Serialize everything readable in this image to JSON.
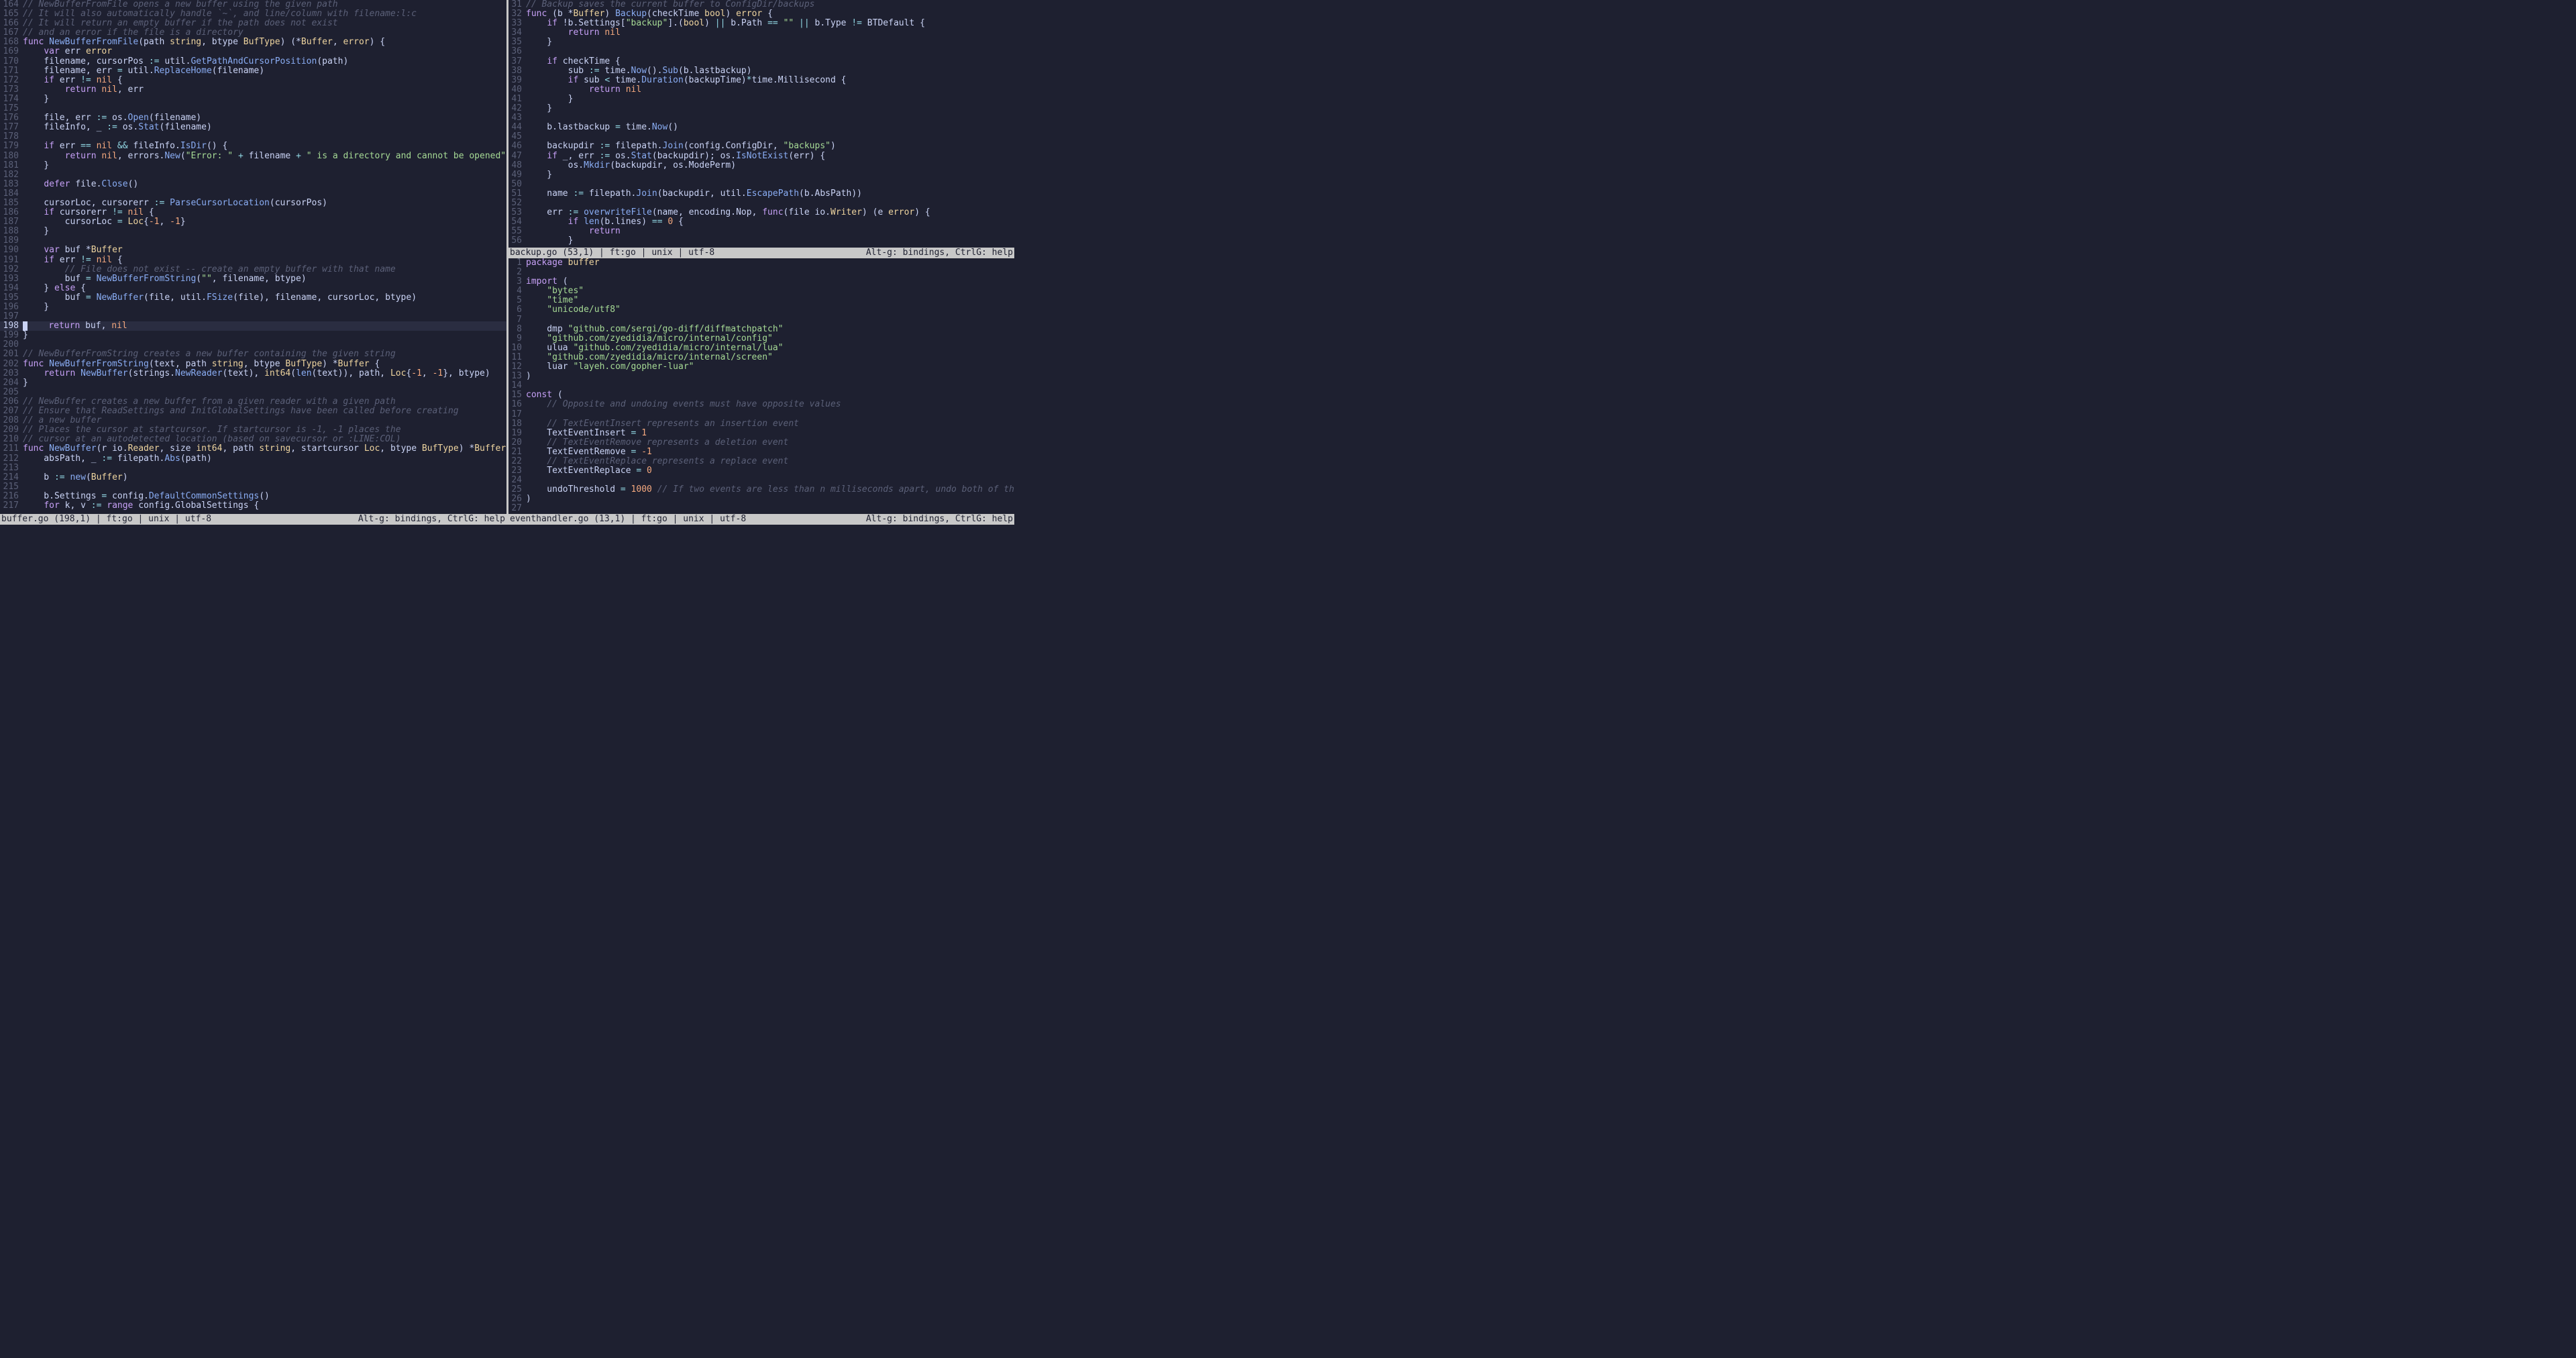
{
  "left": {
    "status_left": "buffer.go (198,1) | ft:go | unix | utf-8",
    "status_right": "Alt-g: bindings, CtrlG: help",
    "cursor_line": 198,
    "start_num": 164,
    "lines": [
      {
        "n": 164,
        "h": "<span class='c'>// NewBufferFromFile opens a new buffer using the given path</span>"
      },
      {
        "n": 165,
        "h": "<span class='c'>// It will also automatically handle `~`, and line/column with filename:l:c</span>"
      },
      {
        "n": 166,
        "h": "<span class='c'>// It will return an empty buffer if the path does not exist</span>"
      },
      {
        "n": 167,
        "h": "<span class='c'>// and an error if the file is a directory</span>"
      },
      {
        "n": 168,
        "h": "<span class='kw'>func</span> <span class='fn'>NewBufferFromFile</span>(path <span class='ty'>string</span>, btype <span class='ty'>BufType</span>) (*<span class='ty'>Buffer</span>, <span class='ty'>error</span>) {"
      },
      {
        "n": 169,
        "h": "    <span class='kw'>var</span> err <span class='ty'>error</span>"
      },
      {
        "n": 170,
        "h": "    filename, cursorPos <span class='op'>:=</span> util.<span class='fn'>GetPathAndCursorPosition</span>(path)"
      },
      {
        "n": 171,
        "h": "    filename, err <span class='op'>=</span> util.<span class='fn'>ReplaceHome</span>(filename)"
      },
      {
        "n": 172,
        "h": "    <span class='kw'>if</span> err <span class='op'>!=</span> <span class='bl'>nil</span> {"
      },
      {
        "n": 173,
        "h": "        <span class='kw'>return</span> <span class='bl'>nil</span>, err"
      },
      {
        "n": 174,
        "h": "    }"
      },
      {
        "n": 175,
        "h": ""
      },
      {
        "n": 176,
        "h": "    file, err <span class='op'>:=</span> os.<span class='fn'>Open</span>(filename)"
      },
      {
        "n": 177,
        "h": "    fileInfo, _ <span class='op'>:=</span> os.<span class='fn'>Stat</span>(filename)"
      },
      {
        "n": 178,
        "h": ""
      },
      {
        "n": 179,
        "h": "    <span class='kw'>if</span> err <span class='op'>==</span> <span class='bl'>nil</span> <span class='op'>&amp;&amp;</span> fileInfo.<span class='fn'>IsDir</span>() {"
      },
      {
        "n": 180,
        "h": "        <span class='kw'>return</span> <span class='bl'>nil</span>, errors.<span class='fn'>New</span>(<span class='st'>\"Error: \"</span> <span class='op'>+</span> filename <span class='op'>+</span> <span class='st'>\" is a directory and cannot be opened\"</span>)"
      },
      {
        "n": 181,
        "h": "    }"
      },
      {
        "n": 182,
        "h": ""
      },
      {
        "n": 183,
        "h": "    <span class='kw'>defer</span> file.<span class='fn'>Close</span>()"
      },
      {
        "n": 184,
        "h": ""
      },
      {
        "n": 185,
        "h": "    cursorLoc, cursorerr <span class='op'>:=</span> <span class='fn'>ParseCursorLocation</span>(cursorPos)"
      },
      {
        "n": 186,
        "h": "    <span class='kw'>if</span> cursorerr <span class='op'>!=</span> <span class='bl'>nil</span> {"
      },
      {
        "n": 187,
        "h": "        cursorLoc <span class='op'>=</span> <span class='ty'>Loc</span>{<span class='nu'>-1</span>, <span class='nu'>-1</span>}"
      },
      {
        "n": 188,
        "h": "    }"
      },
      {
        "n": 189,
        "h": ""
      },
      {
        "n": 190,
        "h": "    <span class='kw'>var</span> buf *<span class='ty'>Buffer</span>"
      },
      {
        "n": 191,
        "h": "    <span class='kw'>if</span> err <span class='op'>!=</span> <span class='bl'>nil</span> {"
      },
      {
        "n": 192,
        "h": "        <span class='c'>// File does not exist -- create an empty buffer with that name</span>"
      },
      {
        "n": 193,
        "h": "        buf <span class='op'>=</span> <span class='fn'>NewBufferFromString</span>(<span class='st'>\"\"</span>, filename, btype)"
      },
      {
        "n": 194,
        "h": "    } <span class='kw'>else</span> {"
      },
      {
        "n": 195,
        "h": "        buf <span class='op'>=</span> <span class='fn'>NewBuffer</span>(file, util.<span class='fn'>FSize</span>(file), filename, cursorLoc, btype)"
      },
      {
        "n": 196,
        "h": "    }"
      },
      {
        "n": 197,
        "h": ""
      },
      {
        "n": 198,
        "h": "    <span class='kw'>return</span> buf, <span class='bl'>nil</span>",
        "cursor": true
      },
      {
        "n": 199,
        "h": "}"
      },
      {
        "n": 200,
        "h": ""
      },
      {
        "n": 201,
        "h": "<span class='c'>// NewBufferFromString creates a new buffer containing the given string</span>"
      },
      {
        "n": 202,
        "h": "<span class='kw'>func</span> <span class='fn'>NewBufferFromString</span>(text, path <span class='ty'>string</span>, btype <span class='ty'>BufType</span>) *<span class='ty'>Buffer</span> {"
      },
      {
        "n": 203,
        "h": "    <span class='kw'>return</span> <span class='fn'>NewBuffer</span>(strings.<span class='fn'>NewReader</span>(text), <span class='ty'>int64</span>(<span class='fn'>len</span>(text)), path, <span class='ty'>Loc</span>{<span class='nu'>-1</span>, <span class='nu'>-1</span>}, btype)"
      },
      {
        "n": 204,
        "h": "}"
      },
      {
        "n": 205,
        "h": ""
      },
      {
        "n": 206,
        "h": "<span class='c'>// NewBuffer creates a new buffer from a given reader with a given path</span>"
      },
      {
        "n": 207,
        "h": "<span class='c'>// Ensure that ReadSettings and InitGlobalSettings have been called before creating</span>"
      },
      {
        "n": 208,
        "h": "<span class='c'>// a new buffer</span>"
      },
      {
        "n": 209,
        "h": "<span class='c'>// Places the cursor at startcursor. If startcursor is -1, -1 places the</span>"
      },
      {
        "n": 210,
        "h": "<span class='c'>// cursor at an autodetected location (based on savecursor or :LINE:COL)</span>"
      },
      {
        "n": 211,
        "h": "<span class='kw'>func</span> <span class='fn'>NewBuffer</span>(r io.<span class='ty'>Reader</span>, size <span class='ty'>int64</span>, path <span class='ty'>string</span>, startcursor <span class='ty'>Loc</span>, btype <span class='ty'>BufType</span>) *<span class='ty'>Buffer</span> {"
      },
      {
        "n": 212,
        "h": "    absPath, _ <span class='op'>:=</span> filepath.<span class='fn'>Abs</span>(path)"
      },
      {
        "n": 213,
        "h": ""
      },
      {
        "n": 214,
        "h": "    b <span class='op'>:=</span> <span class='fn'>new</span>(<span class='ty'>Buffer</span>)"
      },
      {
        "n": 215,
        "h": ""
      },
      {
        "n": 216,
        "h": "    b.Settings <span class='op'>=</span> config.<span class='fn'>DefaultCommonSettings</span>()"
      },
      {
        "n": 217,
        "h": "    <span class='kw'>for</span> k, v <span class='op'>:=</span> <span class='kw'>range</span> config.GlobalSettings {"
      }
    ]
  },
  "top_right": {
    "status_left": "backup.go (53,1) | ft:go | unix | utf-8",
    "status_right": "Alt-g: bindings, CtrlG: help",
    "start_num": 31,
    "lines": [
      {
        "n": 31,
        "h": "<span class='c'>// Backup saves the current buffer to ConfigDir/backups</span>"
      },
      {
        "n": 32,
        "h": "<span class='kw'>func</span> (b *<span class='ty'>Buffer</span>) <span class='fn'>Backup</span>(checkTime <span class='ty'>bool</span>) <span class='ty'>error</span> {"
      },
      {
        "n": 33,
        "h": "    <span class='kw'>if</span> !b.Settings[<span class='st'>\"backup\"</span>].(<span class='ty'>bool</span>) <span class='op'>||</span> b.Path <span class='op'>==</span> <span class='st'>\"\"</span> <span class='op'>||</span> b.Type <span class='op'>!=</span> BTDefault {"
      },
      {
        "n": 34,
        "h": "        <span class='kw'>return</span> <span class='bl'>nil</span>"
      },
      {
        "n": 35,
        "h": "    }"
      },
      {
        "n": 36,
        "h": ""
      },
      {
        "n": 37,
        "h": "    <span class='kw'>if</span> checkTime {"
      },
      {
        "n": 38,
        "h": "        sub <span class='op'>:=</span> time.<span class='fn'>Now</span>().<span class='fn'>Sub</span>(b.lastbackup)"
      },
      {
        "n": 39,
        "h": "        <span class='kw'>if</span> sub <span class='op'>&lt;</span> time.<span class='fn'>Duration</span>(backupTime)<span class='op'>*</span>time.Millisecond {"
      },
      {
        "n": 40,
        "h": "            <span class='kw'>return</span> <span class='bl'>nil</span>"
      },
      {
        "n": 41,
        "h": "        }"
      },
      {
        "n": 42,
        "h": "    }"
      },
      {
        "n": 43,
        "h": ""
      },
      {
        "n": 44,
        "h": "    b.lastbackup <span class='op'>=</span> time.<span class='fn'>Now</span>()"
      },
      {
        "n": 45,
        "h": ""
      },
      {
        "n": 46,
        "h": "    backupdir <span class='op'>:=</span> filepath.<span class='fn'>Join</span>(config.ConfigDir, <span class='st'>\"backups\"</span>)"
      },
      {
        "n": 47,
        "h": "    <span class='kw'>if</span> _, err <span class='op'>:=</span> os.<span class='fn'>Stat</span>(backupdir); os.<span class='fn'>IsNotExist</span>(err) {"
      },
      {
        "n": 48,
        "h": "        os.<span class='fn'>Mkdir</span>(backupdir, os.ModePerm)"
      },
      {
        "n": 49,
        "h": "    }"
      },
      {
        "n": 50,
        "h": ""
      },
      {
        "n": 51,
        "h": "    name <span class='op'>:=</span> filepath.<span class='fn'>Join</span>(backupdir, util.<span class='fn'>EscapePath</span>(b.AbsPath))"
      },
      {
        "n": 52,
        "h": ""
      },
      {
        "n": 53,
        "h": "    err <span class='op'>:=</span> <span class='fn'>overwriteFile</span>(name, encoding.Nop, <span class='kw'>func</span>(file io.<span class='ty'>Writer</span>) (e <span class='ty'>error</span>) {"
      },
      {
        "n": 54,
        "h": "        <span class='kw'>if</span> <span class='fn'>len</span>(b.lines) <span class='op'>==</span> <span class='nu'>0</span> {"
      },
      {
        "n": 55,
        "h": "            <span class='kw'>return</span>"
      },
      {
        "n": 56,
        "h": "        }"
      }
    ]
  },
  "bottom_right": {
    "status_left": "eventhandler.go (13,1) | ft:go | unix | utf-8",
    "status_right": "Alt-g: bindings, CtrlG: help",
    "start_num": 1,
    "lines": [
      {
        "n": 1,
        "h": "<span class='kw'>package</span> <span class='pk'>buffer</span>"
      },
      {
        "n": 2,
        "h": ""
      },
      {
        "n": 3,
        "h": "<span class='kw'>import</span> ("
      },
      {
        "n": 4,
        "h": "    <span class='st'>\"bytes\"</span>"
      },
      {
        "n": 5,
        "h": "    <span class='st'>\"time\"</span>"
      },
      {
        "n": 6,
        "h": "    <span class='st'>\"unicode/utf8\"</span>"
      },
      {
        "n": 7,
        "h": ""
      },
      {
        "n": 8,
        "h": "    dmp <span class='st'>\"github.com/sergi/go-diff/diffmatchpatch\"</span>"
      },
      {
        "n": 9,
        "h": "    <span class='st'>\"github.com/zyedidia/micro/internal/config\"</span>"
      },
      {
        "n": 10,
        "h": "    ulua <span class='st'>\"github.com/zyedidia/micro/internal/lua\"</span>"
      },
      {
        "n": 11,
        "h": "    <span class='st'>\"github.com/zyedidia/micro/internal/screen\"</span>"
      },
      {
        "n": 12,
        "h": "    luar <span class='st'>\"layeh.com/gopher-luar\"</span>"
      },
      {
        "n": 13,
        "h": ")"
      },
      {
        "n": 14,
        "h": ""
      },
      {
        "n": 15,
        "h": "<span class='kw'>const</span> ("
      },
      {
        "n": 16,
        "h": "    <span class='c'>// Opposite and undoing events must have opposite values</span>"
      },
      {
        "n": 17,
        "h": ""
      },
      {
        "n": 18,
        "h": "    <span class='c'>// TextEventInsert represents an insertion event</span>"
      },
      {
        "n": 19,
        "h": "    TextEventInsert <span class='op'>=</span> <span class='nu'>1</span>"
      },
      {
        "n": 20,
        "h": "    <span class='c'>// TextEventRemove represents a deletion event</span>"
      },
      {
        "n": 21,
        "h": "    TextEventRemove <span class='op'>=</span> <span class='nu'>-1</span>"
      },
      {
        "n": 22,
        "h": "    <span class='c'>// TextEventReplace represents a replace event</span>"
      },
      {
        "n": 23,
        "h": "    TextEventReplace <span class='op'>=</span> <span class='nu'>0</span>"
      },
      {
        "n": 24,
        "h": ""
      },
      {
        "n": 25,
        "h": "    undoThreshold <span class='op'>=</span> <span class='nu'>1000</span> <span class='c'>// If two events are less than n milliseconds apart, undo both of them</span>"
      },
      {
        "n": 26,
        "h": ")"
      },
      {
        "n": 27,
        "h": ""
      }
    ]
  }
}
